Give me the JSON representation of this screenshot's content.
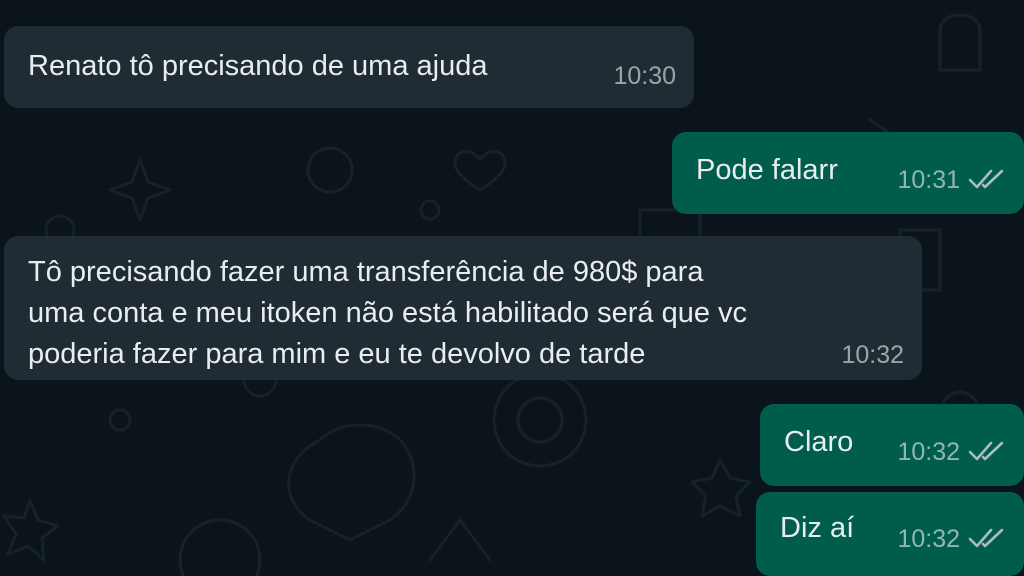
{
  "chat": {
    "messages": [
      {
        "direction": "incoming",
        "text": "Renato tô precisando de uma ajuda",
        "time": "10:30"
      },
      {
        "direction": "outgoing",
        "text": "Pode falarr",
        "time": "10:31",
        "status": "read"
      },
      {
        "direction": "incoming",
        "lines": [
          "Tô precisando fazer uma transferência de 980$ para",
          "uma conta e meu itoken não está habilitado será que vc",
          "poderia fazer para mim e eu te devolvo de tarde"
        ],
        "time": "10:32"
      },
      {
        "direction": "outgoing",
        "text": "Claro",
        "time": "10:32",
        "status": "read"
      },
      {
        "direction": "outgoing",
        "text": "Diz aí",
        "time": "10:32",
        "status": "read"
      }
    ]
  },
  "colors": {
    "background": "#0b141a",
    "incoming_bubble": "#202c33",
    "outgoing_bubble": "#005c4b",
    "text": "#e9edef",
    "read_ticks": "#aebac1"
  },
  "icons": {
    "read_receipt": "double-check-icon"
  }
}
